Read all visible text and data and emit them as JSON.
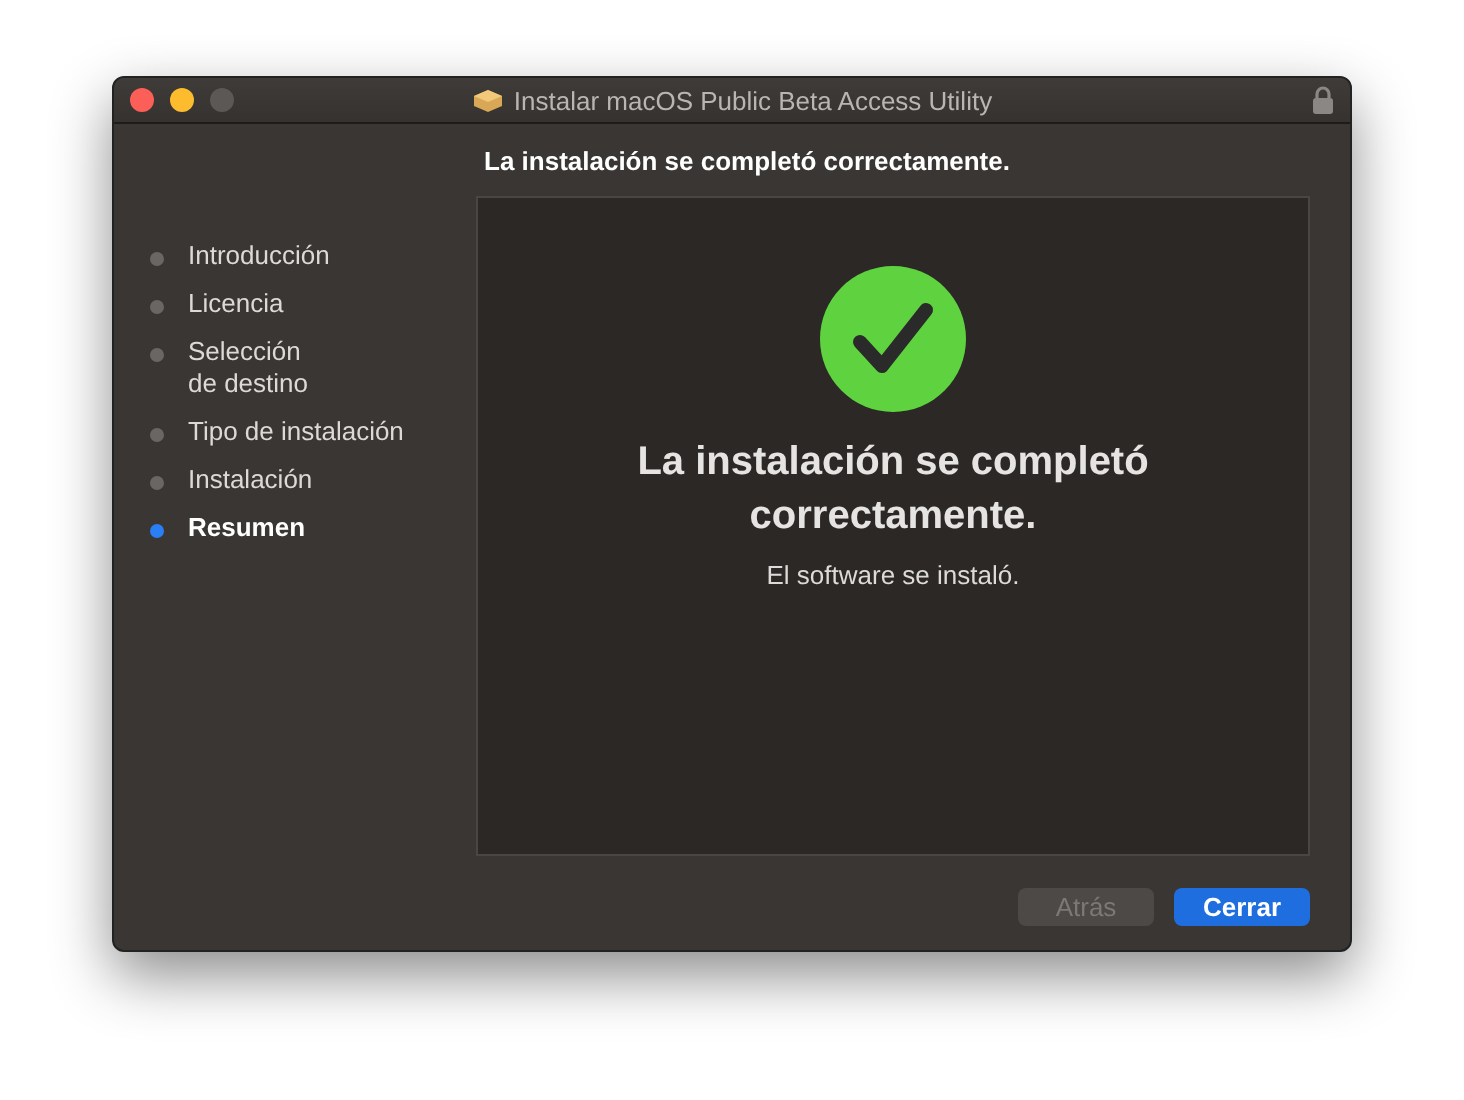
{
  "window": {
    "title": "Instalar macOS Public Beta Access Utility"
  },
  "header": "La instalación se completó correctamente.",
  "steps": [
    {
      "label": "Introducción",
      "selected": false
    },
    {
      "label": "Licencia",
      "selected": false
    },
    {
      "label": "Selección\nde destino",
      "selected": false
    },
    {
      "label": "Tipo de instalación",
      "selected": false
    },
    {
      "label": "Instalación",
      "selected": false
    },
    {
      "label": "Resumen",
      "selected": true
    }
  ],
  "panel": {
    "heading": "La instalación se completó correctamente.",
    "message": "El software se instaló."
  },
  "buttons": [
    {
      "label": "Atrás",
      "disabled": true,
      "default": false
    },
    {
      "label": "Cerrar",
      "disabled": false,
      "default": true
    }
  ]
}
